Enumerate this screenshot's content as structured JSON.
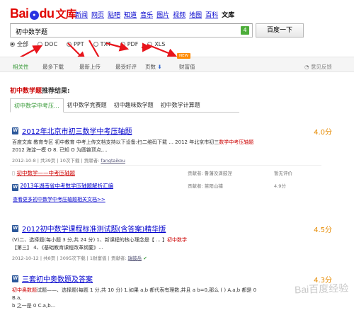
{
  "logo": {
    "bai": "Bai",
    "du": "du",
    "wenku": "文库"
  },
  "nav": [
    "新闻",
    "网页",
    "贴吧",
    "知道",
    "音乐",
    "图片",
    "视频",
    "地图",
    "百科",
    "文库"
  ],
  "search": {
    "value": "初中数学题",
    "count": "4",
    "button": "百度一下"
  },
  "filters": [
    {
      "label": "全部",
      "selected": true
    },
    {
      "label": "DOC",
      "selected": false
    },
    {
      "label": "PPT",
      "selected": false
    },
    {
      "label": "TXT",
      "selected": false
    },
    {
      "label": "PDF",
      "selected": false
    },
    {
      "label": "XLS",
      "selected": false
    }
  ],
  "sort": {
    "items": [
      "相关性",
      "最多下载",
      "最新上传",
      "最受好评",
      "页数",
      "财富值"
    ],
    "new_badge": "NEW",
    "feedback": "意见反馈"
  },
  "heading": {
    "keyword": "初中数学题",
    "suffix": "推荐结果:"
  },
  "tabs": [
    "初中数学中考压...",
    "初中数学竞赛题",
    "初中趣味数学题",
    "初中数学计算题"
  ],
  "results": [
    {
      "title": "2012年北京市初三数学中考压轴题",
      "score": "4.0分",
      "desc1": "百度文库 教育专区 初中教育 中考上传文档支持以下设备:扫二维码下载 ... 2012 年北京市初三",
      "desc1_kw": "数学中考压轴题",
      "desc2": "2012 海淀一模 O 8. 已知 O 为圆锥顶点,...",
      "meta": "2012-10-8 | 共39页 | 10次下载 | 贡献者:",
      "user": "fangtaikou"
    },
    {
      "title": "2012初中数学课程标准测试题(含答案)精华版",
      "score": "4.5分",
      "desc1": "(V)二、选择题(每小题 3 分,共 24 分) 1、新课程的核心理念是【 ... 】",
      "desc1_kw": "初中数学",
      "desc2": "【第三】 4、《基础教育课程改革纲要》...",
      "meta": "2012-10-12 | 共8页 | 3095次下载 | 1财富值 | 贡献者:",
      "user": "瑞鼓岳"
    },
    {
      "title": "三套初中奥数题及答案",
      "score": "4.3分",
      "desc1": "试题——、选择题(每题 1 分,共 10 分) 1.如果 a,b 都代表有理数,并且 a b=0,那么 ( ) A.a,b 都是 0 B.a,",
      "desc1_kw": "初中奥数题",
      "desc2": "b 之一是 0 C.a,b...",
      "meta": "",
      "user": ""
    }
  ],
  "subresults": [
    {
      "title": "初中数学——中考压轴题",
      "contrib": "贡献者: 鲁藩没滴鼓涅",
      "rating": "暂无评价"
    },
    {
      "title": "2013年湖南省中考数学压轴题解析汇编",
      "contrib": "贡献者: 苗阳山捕",
      "rating": "4.9分"
    }
  ],
  "more": "查看更多初中数学中考压轴题相关文档>>",
  "watermark": "Bai百度经验"
}
